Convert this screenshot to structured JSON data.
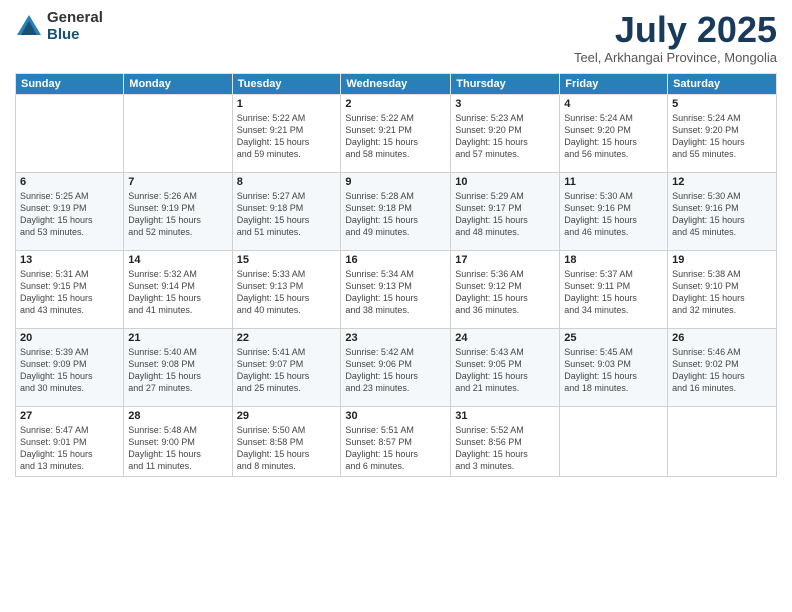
{
  "header": {
    "logo_general": "General",
    "logo_blue": "Blue",
    "month": "July 2025",
    "location": "Teel, Arkhangai Province, Mongolia"
  },
  "columns": [
    "Sunday",
    "Monday",
    "Tuesday",
    "Wednesday",
    "Thursday",
    "Friday",
    "Saturday"
  ],
  "weeks": [
    [
      {
        "day": "",
        "info": ""
      },
      {
        "day": "",
        "info": ""
      },
      {
        "day": "1",
        "info": "Sunrise: 5:22 AM\nSunset: 9:21 PM\nDaylight: 15 hours\nand 59 minutes."
      },
      {
        "day": "2",
        "info": "Sunrise: 5:22 AM\nSunset: 9:21 PM\nDaylight: 15 hours\nand 58 minutes."
      },
      {
        "day": "3",
        "info": "Sunrise: 5:23 AM\nSunset: 9:20 PM\nDaylight: 15 hours\nand 57 minutes."
      },
      {
        "day": "4",
        "info": "Sunrise: 5:24 AM\nSunset: 9:20 PM\nDaylight: 15 hours\nand 56 minutes."
      },
      {
        "day": "5",
        "info": "Sunrise: 5:24 AM\nSunset: 9:20 PM\nDaylight: 15 hours\nand 55 minutes."
      }
    ],
    [
      {
        "day": "6",
        "info": "Sunrise: 5:25 AM\nSunset: 9:19 PM\nDaylight: 15 hours\nand 53 minutes."
      },
      {
        "day": "7",
        "info": "Sunrise: 5:26 AM\nSunset: 9:19 PM\nDaylight: 15 hours\nand 52 minutes."
      },
      {
        "day": "8",
        "info": "Sunrise: 5:27 AM\nSunset: 9:18 PM\nDaylight: 15 hours\nand 51 minutes."
      },
      {
        "day": "9",
        "info": "Sunrise: 5:28 AM\nSunset: 9:18 PM\nDaylight: 15 hours\nand 49 minutes."
      },
      {
        "day": "10",
        "info": "Sunrise: 5:29 AM\nSunset: 9:17 PM\nDaylight: 15 hours\nand 48 minutes."
      },
      {
        "day": "11",
        "info": "Sunrise: 5:30 AM\nSunset: 9:16 PM\nDaylight: 15 hours\nand 46 minutes."
      },
      {
        "day": "12",
        "info": "Sunrise: 5:30 AM\nSunset: 9:16 PM\nDaylight: 15 hours\nand 45 minutes."
      }
    ],
    [
      {
        "day": "13",
        "info": "Sunrise: 5:31 AM\nSunset: 9:15 PM\nDaylight: 15 hours\nand 43 minutes."
      },
      {
        "day": "14",
        "info": "Sunrise: 5:32 AM\nSunset: 9:14 PM\nDaylight: 15 hours\nand 41 minutes."
      },
      {
        "day": "15",
        "info": "Sunrise: 5:33 AM\nSunset: 9:13 PM\nDaylight: 15 hours\nand 40 minutes."
      },
      {
        "day": "16",
        "info": "Sunrise: 5:34 AM\nSunset: 9:13 PM\nDaylight: 15 hours\nand 38 minutes."
      },
      {
        "day": "17",
        "info": "Sunrise: 5:36 AM\nSunset: 9:12 PM\nDaylight: 15 hours\nand 36 minutes."
      },
      {
        "day": "18",
        "info": "Sunrise: 5:37 AM\nSunset: 9:11 PM\nDaylight: 15 hours\nand 34 minutes."
      },
      {
        "day": "19",
        "info": "Sunrise: 5:38 AM\nSunset: 9:10 PM\nDaylight: 15 hours\nand 32 minutes."
      }
    ],
    [
      {
        "day": "20",
        "info": "Sunrise: 5:39 AM\nSunset: 9:09 PM\nDaylight: 15 hours\nand 30 minutes."
      },
      {
        "day": "21",
        "info": "Sunrise: 5:40 AM\nSunset: 9:08 PM\nDaylight: 15 hours\nand 27 minutes."
      },
      {
        "day": "22",
        "info": "Sunrise: 5:41 AM\nSunset: 9:07 PM\nDaylight: 15 hours\nand 25 minutes."
      },
      {
        "day": "23",
        "info": "Sunrise: 5:42 AM\nSunset: 9:06 PM\nDaylight: 15 hours\nand 23 minutes."
      },
      {
        "day": "24",
        "info": "Sunrise: 5:43 AM\nSunset: 9:05 PM\nDaylight: 15 hours\nand 21 minutes."
      },
      {
        "day": "25",
        "info": "Sunrise: 5:45 AM\nSunset: 9:03 PM\nDaylight: 15 hours\nand 18 minutes."
      },
      {
        "day": "26",
        "info": "Sunrise: 5:46 AM\nSunset: 9:02 PM\nDaylight: 15 hours\nand 16 minutes."
      }
    ],
    [
      {
        "day": "27",
        "info": "Sunrise: 5:47 AM\nSunset: 9:01 PM\nDaylight: 15 hours\nand 13 minutes."
      },
      {
        "day": "28",
        "info": "Sunrise: 5:48 AM\nSunset: 9:00 PM\nDaylight: 15 hours\nand 11 minutes."
      },
      {
        "day": "29",
        "info": "Sunrise: 5:50 AM\nSunset: 8:58 PM\nDaylight: 15 hours\nand 8 minutes."
      },
      {
        "day": "30",
        "info": "Sunrise: 5:51 AM\nSunset: 8:57 PM\nDaylight: 15 hours\nand 6 minutes."
      },
      {
        "day": "31",
        "info": "Sunrise: 5:52 AM\nSunset: 8:56 PM\nDaylight: 15 hours\nand 3 minutes."
      },
      {
        "day": "",
        "info": ""
      },
      {
        "day": "",
        "info": ""
      }
    ]
  ]
}
